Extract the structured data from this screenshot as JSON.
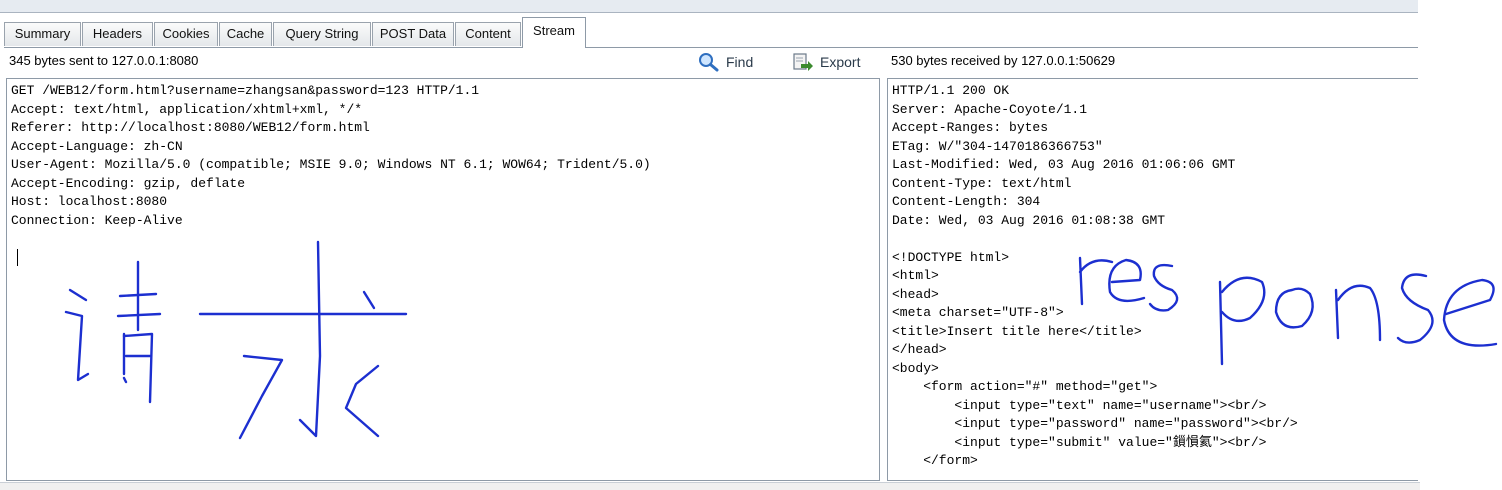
{
  "tabs": [
    {
      "label": "Summary"
    },
    {
      "label": "Headers"
    },
    {
      "label": "Cookies"
    },
    {
      "label": "Cache"
    },
    {
      "label": "Query String"
    },
    {
      "label": "POST Data"
    },
    {
      "label": "Content"
    },
    {
      "label": "Stream"
    }
  ],
  "active_tab": "Stream",
  "request": {
    "status": "345 bytes sent to 127.0.0.1:8080",
    "lines": [
      "GET /WEB12/form.html?username=zhangsan&password=123 HTTP/1.1",
      "Accept: text/html, application/xhtml+xml, */*",
      "Referer: http://localhost:8080/WEB12/form.html",
      "Accept-Language: zh-CN",
      "User-Agent: Mozilla/5.0 (compatible; MSIE 9.0; Windows NT 6.1; WOW64; Trident/5.0)",
      "Accept-Encoding: gzip, deflate",
      "Host: localhost:8080",
      "Connection: Keep-Alive"
    ]
  },
  "toolbar": {
    "find_label": "Find",
    "export_label": "Export"
  },
  "response": {
    "status": "530 bytes received by 127.0.0.1:50629",
    "lines": [
      "HTTP/1.1 200 OK",
      "Server: Apache-Coyote/1.1",
      "Accept-Ranges: bytes",
      "ETag: W/\"304-1470186366753\"",
      "Last-Modified: Wed, 03 Aug 2016 01:06:06 GMT",
      "Content-Type: text/html",
      "Content-Length: 304",
      "Date: Wed, 03 Aug 2016 01:08:38 GMT",
      "",
      "<!DOCTYPE html>",
      "<html>",
      "<head>",
      "<meta charset=\"UTF-8\">",
      "<title>Insert title here</title>",
      "</head>",
      "<body>",
      "    <form action=\"#\" method=\"get\">",
      "        <input type=\"text\" name=\"username\"><br/>",
      "        <input type=\"password\" name=\"password\"><br/>",
      "        <input type=\"submit\" value=\"鎻愪氦\"><br/>",
      "    </form>"
    ]
  },
  "annotations": {
    "left_handwriting": "请求",
    "right_handwriting": "response",
    "ink_color": "#1c2fd0"
  }
}
